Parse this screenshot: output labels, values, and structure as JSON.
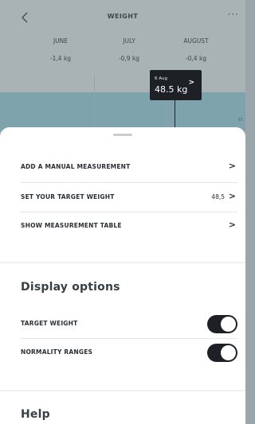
{
  "header": {
    "title": "WEIGHT",
    "back_icon": "chevron-left-icon",
    "more_icon": "more-dots-icon",
    "more_glyph": "···"
  },
  "months": [
    {
      "name": "JUNE",
      "delta": "-1,4 kg"
    },
    {
      "name": "JULY",
      "delta": "-0,9 kg"
    },
    {
      "name": "AUGUST",
      "delta": "-0,4 kg"
    }
  ],
  "chart": {
    "target_tick": "65",
    "tooltip": {
      "date": "6 Aug",
      "value": "48.5 kg",
      "chevron": ">"
    }
  },
  "actions": [
    {
      "label": "ADD A MANUAL MEASUREMENT",
      "value": "",
      "chevron": ">"
    },
    {
      "label": "SET YOUR TARGET WEIGHT",
      "value": "48,5",
      "chevron": ">"
    },
    {
      "label": "SHOW MEASUREMENT TABLE",
      "value": "",
      "chevron": ">"
    }
  ],
  "display_options": {
    "title": "Display options",
    "items": [
      {
        "label": "TARGET WEIGHT",
        "enabled": true
      },
      {
        "label": "NORMALITY RANGES",
        "enabled": true
      }
    ]
  },
  "help": {
    "title": "Help"
  },
  "colors": {
    "toggle_on": "#1d2125",
    "overlay": "#a9b3b6",
    "normal_band": "#7fa3ac"
  }
}
